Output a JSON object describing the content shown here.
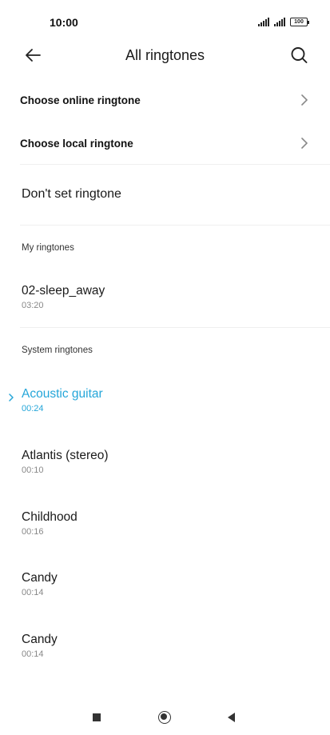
{
  "status": {
    "time": "10:00",
    "battery": "100"
  },
  "header": {
    "title": "All ringtones"
  },
  "menu": [
    {
      "label": "Choose online ringtone"
    },
    {
      "label": "Choose local ringtone"
    }
  ],
  "no_ringtone_label": "Don't set ringtone",
  "my_ringtones": {
    "header": "My ringtones",
    "items": [
      {
        "name": "02-sleep_away",
        "duration": "03:20"
      }
    ]
  },
  "system_ringtones": {
    "header": "System ringtones",
    "items": [
      {
        "name": "Acoustic guitar",
        "duration": "00:24",
        "selected": true
      },
      {
        "name": "Atlantis (stereo)",
        "duration": "00:10"
      },
      {
        "name": "Childhood",
        "duration": "00:16"
      },
      {
        "name": "Candy",
        "duration": "00:14"
      },
      {
        "name": "Candy",
        "duration": "00:14"
      }
    ]
  },
  "colors": {
    "accent": "#25a6d9",
    "text": "#1a1a1a",
    "secondary": "#888888"
  }
}
